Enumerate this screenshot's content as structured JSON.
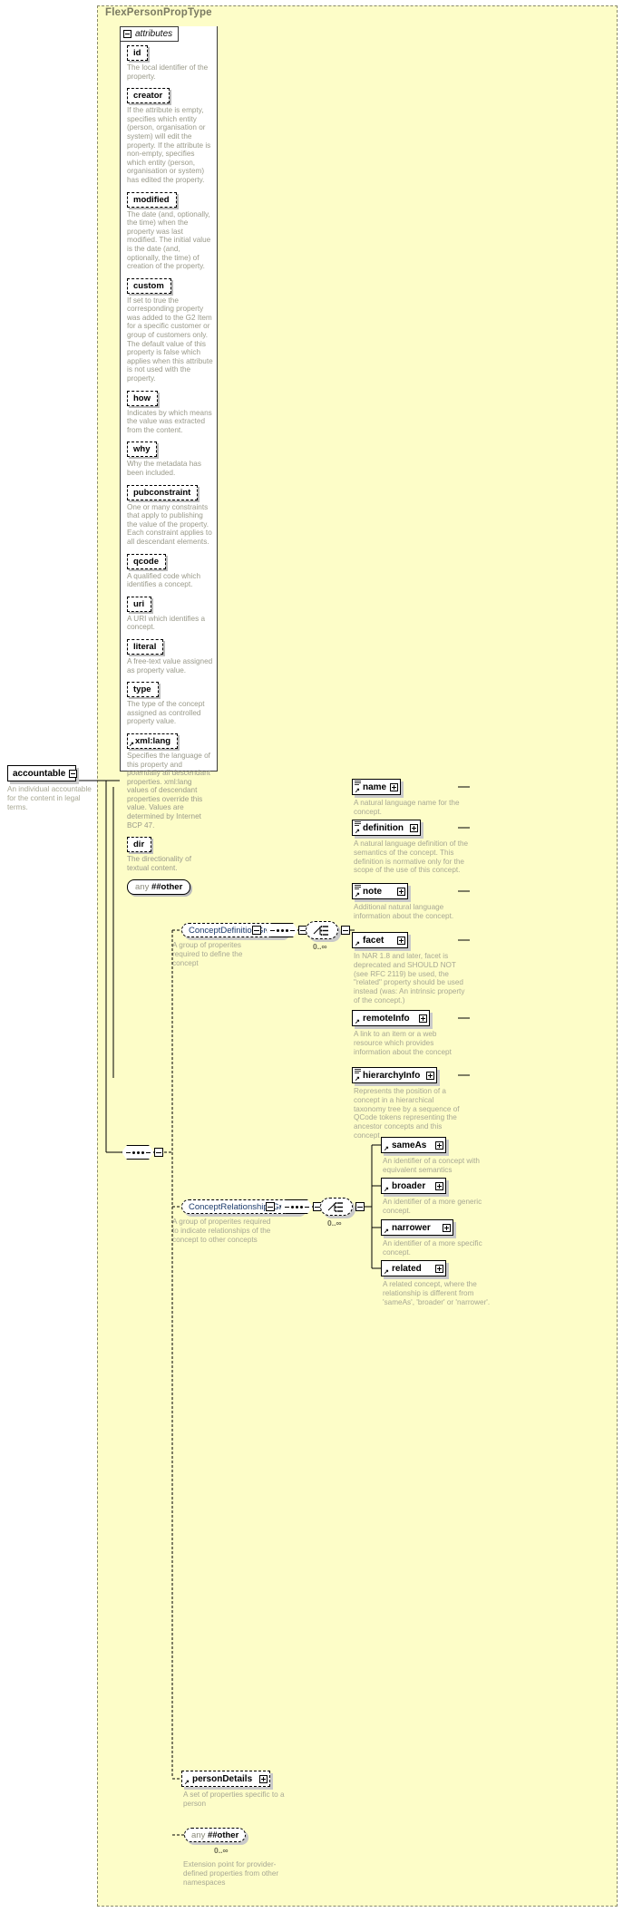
{
  "diagram": {
    "title": "FlexPersonPropType",
    "attributes_label": "attributes",
    "any_other_label_word": "any",
    "any_other_ns": "##other"
  },
  "attributes": [
    {
      "name": "id",
      "desc": "The local identifier of the property."
    },
    {
      "name": "creator",
      "desc": "If the attribute is empty, specifies which entity (person, organisation or system) will edit the property. If the attribute is non-empty, specifies which entity (person, organisation or system) has edited the property."
    },
    {
      "name": "modified",
      "desc": "The date (and, optionally, the time) when the property was last modified. The initial value is the date (and, optionally, the time) of creation of the property."
    },
    {
      "name": "custom",
      "desc": "If set to true the corresponding property was added to the G2 Item for a specific customer or group of customers only. The default value of this property is false which applies when this attribute is not used with the property."
    },
    {
      "name": "how",
      "desc": "Indicates by which means the value was extracted from the content."
    },
    {
      "name": "why",
      "desc": "Why the metadata has been included."
    },
    {
      "name": "pubconstraint",
      "desc": "One or many constraints that apply to publishing the value of the property. Each constraint applies to all descendant elements."
    },
    {
      "name": "qcode",
      "desc": "A qualified code which identifies a concept."
    },
    {
      "name": "uri",
      "desc": "A URI which identifies a concept."
    },
    {
      "name": "literal",
      "desc": "A free-text value assigned as property value."
    },
    {
      "name": "type",
      "desc": "The type of the concept assigned as controlled property value."
    },
    {
      "name": "xml:lang",
      "desc": "Specifies the language of this property and potentially all descendant properties. xml:lang values of descendant properties override this value. Values are determined by Internet BCP 47."
    },
    {
      "name": "dir",
      "desc": "The directionality of textual content."
    }
  ],
  "root_element": {
    "name": "accountable",
    "desc": "An individual accountable for the content in legal terms."
  },
  "groups": {
    "concept_definition": {
      "name": "ConceptDefinitionGroup",
      "desc": "A group of properites required to define the concept",
      "occurrence": "0..∞",
      "children": [
        {
          "name": "name",
          "desc": "A natural language name for the concept."
        },
        {
          "name": "definition",
          "desc": "A natural language definition of the semantics of the concept. This definition is normative only for the scope of the use of this concept."
        },
        {
          "name": "note",
          "desc": "Additional natural language information about the concept."
        },
        {
          "name": "facet",
          "desc": "In NAR 1.8 and later, facet is deprecated and SHOULD NOT (see RFC 2119) be used, the \"related\" property should be used instead (was: An intrinsic property of the concept.)"
        },
        {
          "name": "remoteInfo",
          "desc": "A link to an item or a web resource which provides information about the concept"
        },
        {
          "name": "hierarchyInfo",
          "desc": "Represents the position of a concept in a hierarchical taxonomy tree by a sequence of QCode tokens representing the ancestor concepts and this concept"
        }
      ]
    },
    "concept_relationships": {
      "name": "ConceptRelationshipsGroup",
      "desc": "A group of properites required to indicate relationships of the concept to other concepts",
      "occurrence": "0..∞",
      "children": [
        {
          "name": "sameAs",
          "desc": "An identifier of a concept with equivalent semantics"
        },
        {
          "name": "broader",
          "desc": "An identifier of a more generic concept."
        },
        {
          "name": "narrower",
          "desc": "An identifier of a more specific concept."
        },
        {
          "name": "related",
          "desc": "A related concept, where the relationship is different from 'sameAs', 'broader' or 'narrower'."
        }
      ]
    }
  },
  "extras": [
    {
      "name": "personDetails",
      "desc": "A set of properties specific to a person"
    }
  ],
  "extension": {
    "any_word": "any",
    "ns": "##other",
    "occurrence": "0..∞",
    "desc": "Extension point for provider-defined properties from other namespaces"
  },
  "colors": {
    "panel_bg": "#fdfdc8",
    "panel_border": "#8a8a6a",
    "element_border": "#000000",
    "shadow": "#c9c9c9",
    "desc_text": "#a8a894",
    "group_text": "#1b3a6b"
  }
}
